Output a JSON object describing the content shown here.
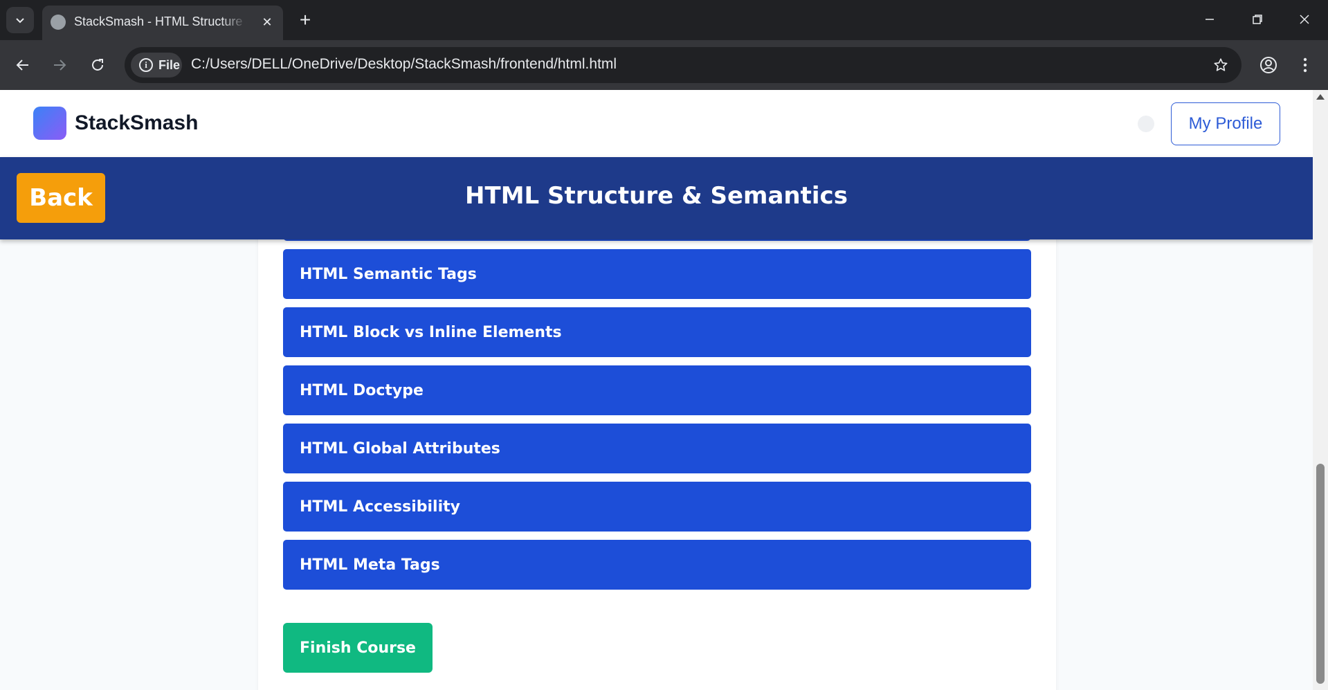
{
  "browser": {
    "tab_title": "StackSmash - HTML Structure & Semantics",
    "site_chip_label": "File",
    "url": "C:/Users/DELL/OneDrive/Desktop/StackSmash/frontend/html.html"
  },
  "header": {
    "logo_text": "StackSmash",
    "profile_button": "My Profile"
  },
  "course": {
    "back_label": "Back",
    "title": "HTML Structure & Semantics"
  },
  "topics": [
    "HTML Semantic Tags",
    "HTML Block vs Inline Elements",
    "HTML Doctype",
    "HTML Global Attributes",
    "HTML Accessibility",
    "HTML Meta Tags"
  ],
  "finish_button": "Finish Course",
  "colors": {
    "course_bar": "#1e3a8a",
    "back_button": "#f59e0b",
    "topic_button": "#1d4ed8",
    "finish_button": "#10b981",
    "profile_accent": "#2d5bd6"
  }
}
